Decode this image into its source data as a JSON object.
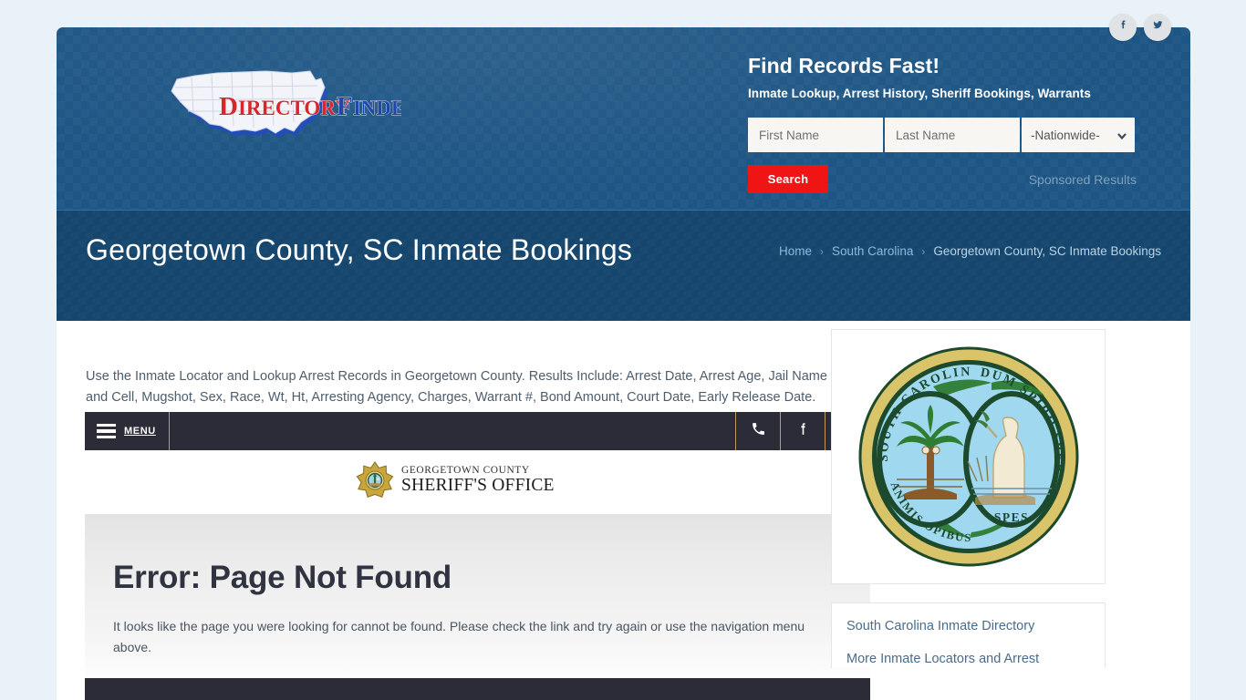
{
  "social": [
    {
      "name": "facebook",
      "label": "Facebook"
    },
    {
      "name": "twitter",
      "label": "Twitter"
    }
  ],
  "header": {
    "logo_primary": "DIRECTORY",
    "logo_secondary": "FINDER",
    "title": "Find Records Fast!",
    "subtitle": "Inmate Lookup, Arrest History, Sheriff Bookings, Warrants",
    "search": {
      "first_name_placeholder": "First Name",
      "first_name_value": "",
      "last_name_placeholder": "Last Name",
      "last_name_value": "",
      "state_selected": "-Nationwide-",
      "state_options": [
        "-Nationwide-"
      ],
      "search_label": "Search",
      "sponsored_label": "Sponsored Results"
    }
  },
  "title_band": {
    "page_title": "Georgetown County, SC Inmate Bookings",
    "breadcrumb": {
      "home": "Home",
      "state": "South Carolina",
      "current": "Georgetown County, SC Inmate Bookings",
      "separator": "›"
    }
  },
  "main": {
    "intro": "Use the Inmate Locator and Lookup Arrest Records in Georgetown County. Results Include: Arrest Date, Arrest Age, Jail Name and Cell, Mugshot, Sex, Race, Wt, Ht, Arresting Agency, Charges, Warrant #, Bond Amount, Court Date, Early Release Date.",
    "embedded_nav": {
      "menu_label": "MENU",
      "icons": [
        "phone-icon",
        "facebook-icon",
        "accessibility-icon"
      ]
    },
    "sheriff_logo": {
      "line1": "GEORGETOWN COUNTY",
      "line2": "SHERIFF'S OFFICE"
    },
    "error": {
      "title": "Error: Page Not Found",
      "body": "It looks like the page you were looking for cannot be found. Please check the link and try again or use the navigation menu above."
    }
  },
  "sidebar": {
    "seal": {
      "left_top_text": "SOUTH CAROLINA",
      "left_bottom_text": "ANIMIS OPIBUSQUE PARATI",
      "right_top_text": "DUM SPIRO SPERO",
      "right_bottom_text": "SPES"
    },
    "links": [
      "South Carolina Inmate Directory",
      "More Inmate Locators and Arrest"
    ]
  },
  "colors": {
    "header_blue": "#1d5584",
    "title_blue": "#15466e",
    "search_red": "#f01414",
    "nav_dark": "#2b2c38",
    "nav_gold": "#c39a5a",
    "page_bg": "#e8f2f8",
    "link_blue": "#4a6b8a"
  }
}
